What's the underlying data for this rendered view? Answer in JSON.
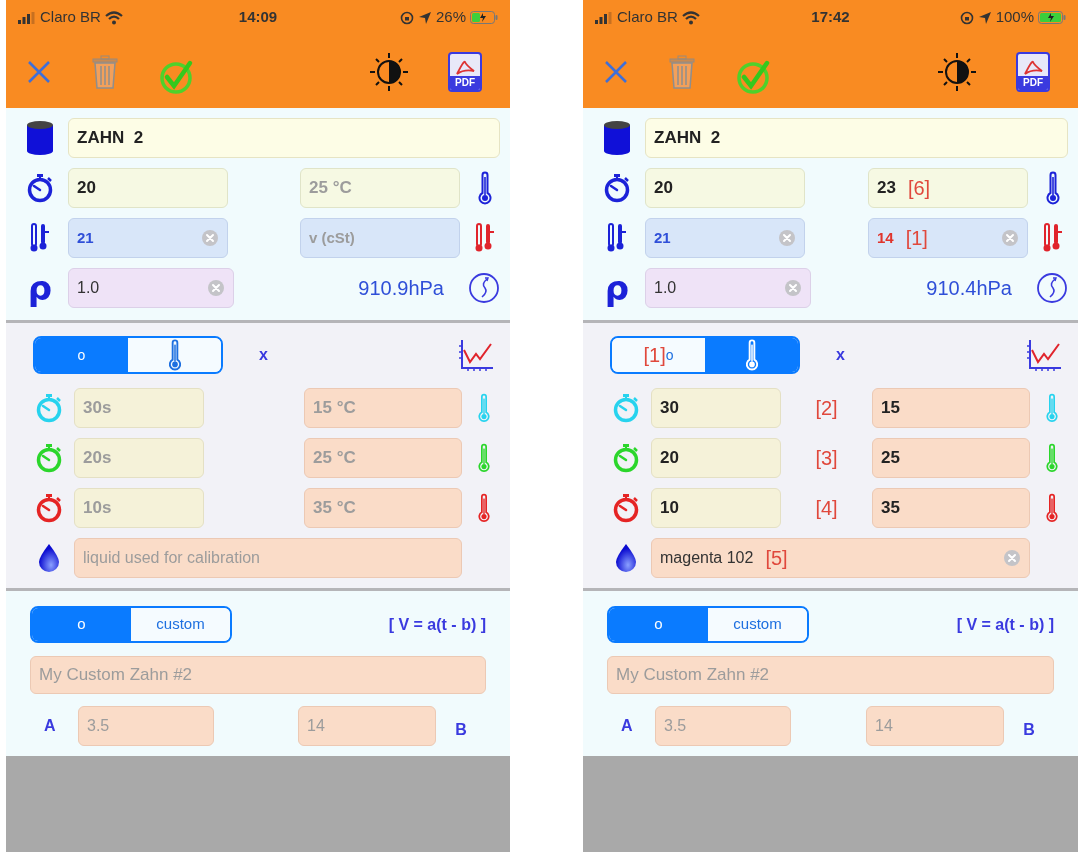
{
  "phones": [
    {
      "status_bar": {
        "carrier": "Claro BR",
        "time": "14:09",
        "battery": "26%"
      },
      "toolbar": {
        "pdf_label": "PDF"
      },
      "name": {
        "value": "ZAHN  2"
      },
      "efflux_time": {
        "value": "20"
      },
      "temperature": {
        "placeholder": "25 °C"
      },
      "cup_number": {
        "value": "21",
        "clear_button": true
      },
      "viscosity": {
        "placeholder": "v (cSt)",
        "clear_button": false
      },
      "density_symbol": "ρ",
      "density": {
        "value": "1.0",
        "clear_button": true
      },
      "pressure": "910.9hPa",
      "mode_switch": [
        {
          "kind": "text",
          "label": "o",
          "selected": true
        },
        {
          "kind": "thermometer",
          "selected": false
        }
      ],
      "x_label": "x",
      "calibration": [
        {
          "color": "#27d3ee",
          "time": {
            "placeholder": "30s"
          },
          "temperature": {
            "placeholder": "15 °C"
          }
        },
        {
          "color": "#2bd62b",
          "time": {
            "placeholder": "20s"
          },
          "temperature": {
            "placeholder": "25 °C"
          }
        },
        {
          "color": "#e52424",
          "time": {
            "placeholder": "10s"
          },
          "temperature": {
            "placeholder": "35 °C"
          }
        }
      ],
      "liquid": {
        "placeholder": "liquid used for calibration",
        "clear_button": false
      },
      "formula_switch": [
        {
          "label": "o",
          "selected": true
        },
        {
          "label": "custom",
          "selected": false
        }
      ],
      "formula": "[ V = a(t - b) ]",
      "custom_name": {
        "placeholder": "My Custom Zahn #2"
      },
      "a": {
        "label": "A",
        "placeholder": "3.5"
      },
      "b": {
        "label": "B",
        "placeholder": "14"
      }
    },
    {
      "status_bar": {
        "carrier": "Claro BR",
        "time": "17:42",
        "battery": "100%"
      },
      "toolbar": {
        "pdf_label": "PDF"
      },
      "name": {
        "value": "ZAHN  2"
      },
      "efflux_time": {
        "value": "20"
      },
      "temperature": {
        "value": "23",
        "note": "[6]"
      },
      "cup_number": {
        "value": "21",
        "clear_button": true
      },
      "viscosity": {
        "value": "14",
        "note": "[1]",
        "clear_button": true
      },
      "density_symbol": "ρ",
      "density": {
        "value": "1.0",
        "clear_button": true
      },
      "pressure": "910.4hPa",
      "mode_switch": [
        {
          "kind": "text",
          "note": "[1]",
          "label": "o",
          "selected": false
        },
        {
          "kind": "thermometer",
          "selected": true
        }
      ],
      "x_label": "x",
      "calibration": [
        {
          "color": "#27d3ee",
          "time": {
            "value": "30"
          },
          "note": "[2]",
          "temperature": {
            "value": "15"
          }
        },
        {
          "color": "#2bd62b",
          "time": {
            "value": "20"
          },
          "note": "[3]",
          "temperature": {
            "value": "25"
          }
        },
        {
          "color": "#e52424",
          "time": {
            "value": "10"
          },
          "note": "[4]",
          "temperature": {
            "value": "35"
          }
        }
      ],
      "liquid": {
        "value": "magenta 102",
        "note": "[5]",
        "clear_button": true
      },
      "formula_switch": [
        {
          "label": "o",
          "selected": true
        },
        {
          "label": "custom",
          "selected": false
        }
      ],
      "formula": "[ V = a(t - b) ]",
      "custom_name": {
        "placeholder": "My Custom Zahn #2"
      },
      "a": {
        "label": "A",
        "placeholder": "3.5"
      },
      "b": {
        "label": "B",
        "placeholder": "14"
      }
    }
  ]
}
